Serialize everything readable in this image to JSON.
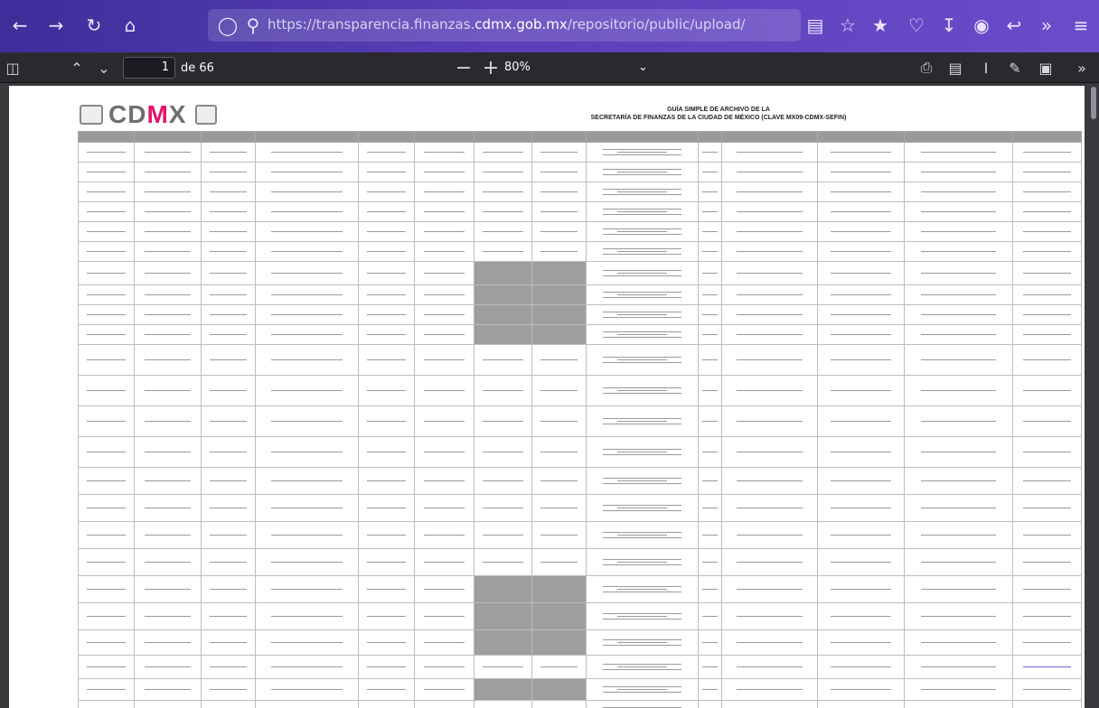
{
  "browser": {
    "url_prefix": "https://transparencia.finanzas.",
    "url_host": "cdmx.gob.mx",
    "url_suffix": "/repositorio/public/upload/"
  },
  "pdf_toolbar": {
    "page_current": "1",
    "page_of": "de 66",
    "zoom": "80%"
  },
  "document": {
    "logo": "CDMX",
    "title_line1": "GUÍA SIMPLE DE ARCHIVO DE LA",
    "title_line2": "SECRETARÍA DE FINANZAS DE LA CIUDAD DE MÉXICO (CLAVE MX09-CDMX-SEFIN)"
  },
  "colors": {
    "toolbar_start": "#3d2e9a",
    "toolbar_end": "#6b4cc9",
    "logo_accent": "#e0136d"
  }
}
